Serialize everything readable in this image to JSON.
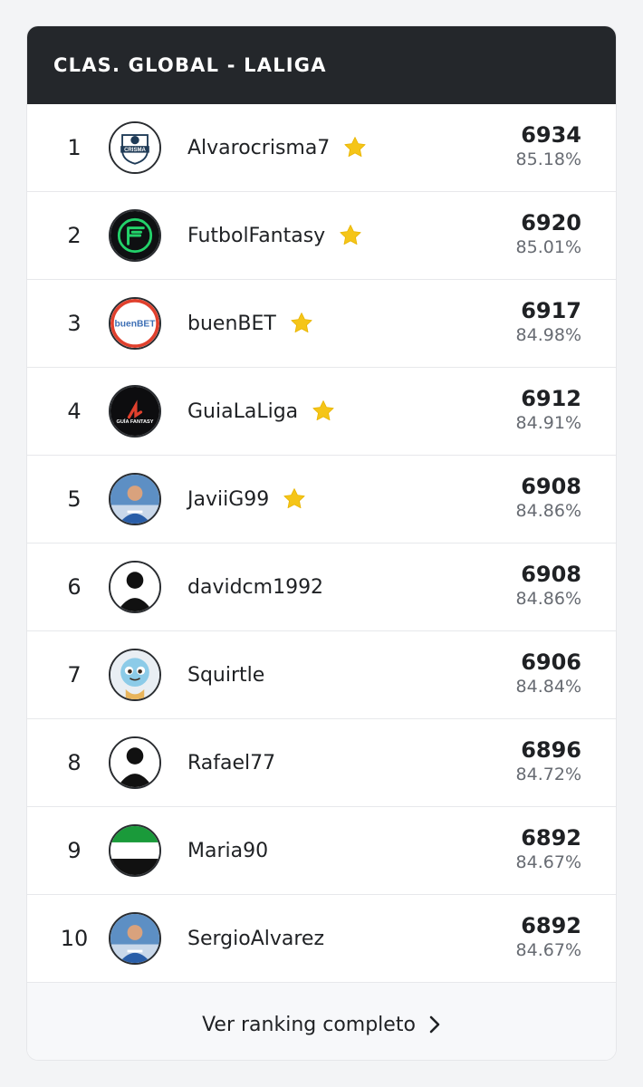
{
  "header": {
    "title": "CLAS. GLOBAL - LALIGA"
  },
  "rows": [
    {
      "rank": "1",
      "name": "Alvarocrisma7",
      "star": true,
      "points": "6934",
      "pct": "85.18%",
      "avatar": "crisma-logo",
      "avatar_text": "CRISMA"
    },
    {
      "rank": "2",
      "name": "FutbolFantasy",
      "star": true,
      "points": "6920",
      "pct": "85.01%",
      "avatar": "ff-logo"
    },
    {
      "rank": "3",
      "name": "buenBET",
      "star": true,
      "points": "6917",
      "pct": "84.98%",
      "avatar": "buenbet-logo",
      "avatar_text": "buenBET"
    },
    {
      "rank": "4",
      "name": "GuiaLaLiga",
      "star": true,
      "points": "6912",
      "pct": "84.91%",
      "avatar": "guia-logo",
      "avatar_text": "GUÍA FANTASY"
    },
    {
      "rank": "5",
      "name": "JaviiG99",
      "star": true,
      "points": "6908",
      "pct": "84.86%",
      "avatar": "player-photo"
    },
    {
      "rank": "6",
      "name": "davidcm1992",
      "star": false,
      "points": "6908",
      "pct": "84.86%",
      "avatar": "default-silhouette"
    },
    {
      "rank": "7",
      "name": "Squirtle",
      "star": false,
      "points": "6906",
      "pct": "84.84%",
      "avatar": "squirtle-image"
    },
    {
      "rank": "8",
      "name": "Rafael77",
      "star": false,
      "points": "6896",
      "pct": "84.72%",
      "avatar": "default-silhouette"
    },
    {
      "rank": "9",
      "name": "Maria90",
      "star": false,
      "points": "6892",
      "pct": "84.67%",
      "avatar": "flag"
    },
    {
      "rank": "10",
      "name": "SergioAlvarez",
      "star": false,
      "points": "6892",
      "pct": "84.67%",
      "avatar": "player-photo"
    }
  ],
  "footer": {
    "label": "Ver ranking completo",
    "icon": "chevron-right-icon"
  },
  "colors": {
    "header_bg": "#24272b",
    "star": "#f5c518",
    "flag_green": "#1a9a3a"
  }
}
